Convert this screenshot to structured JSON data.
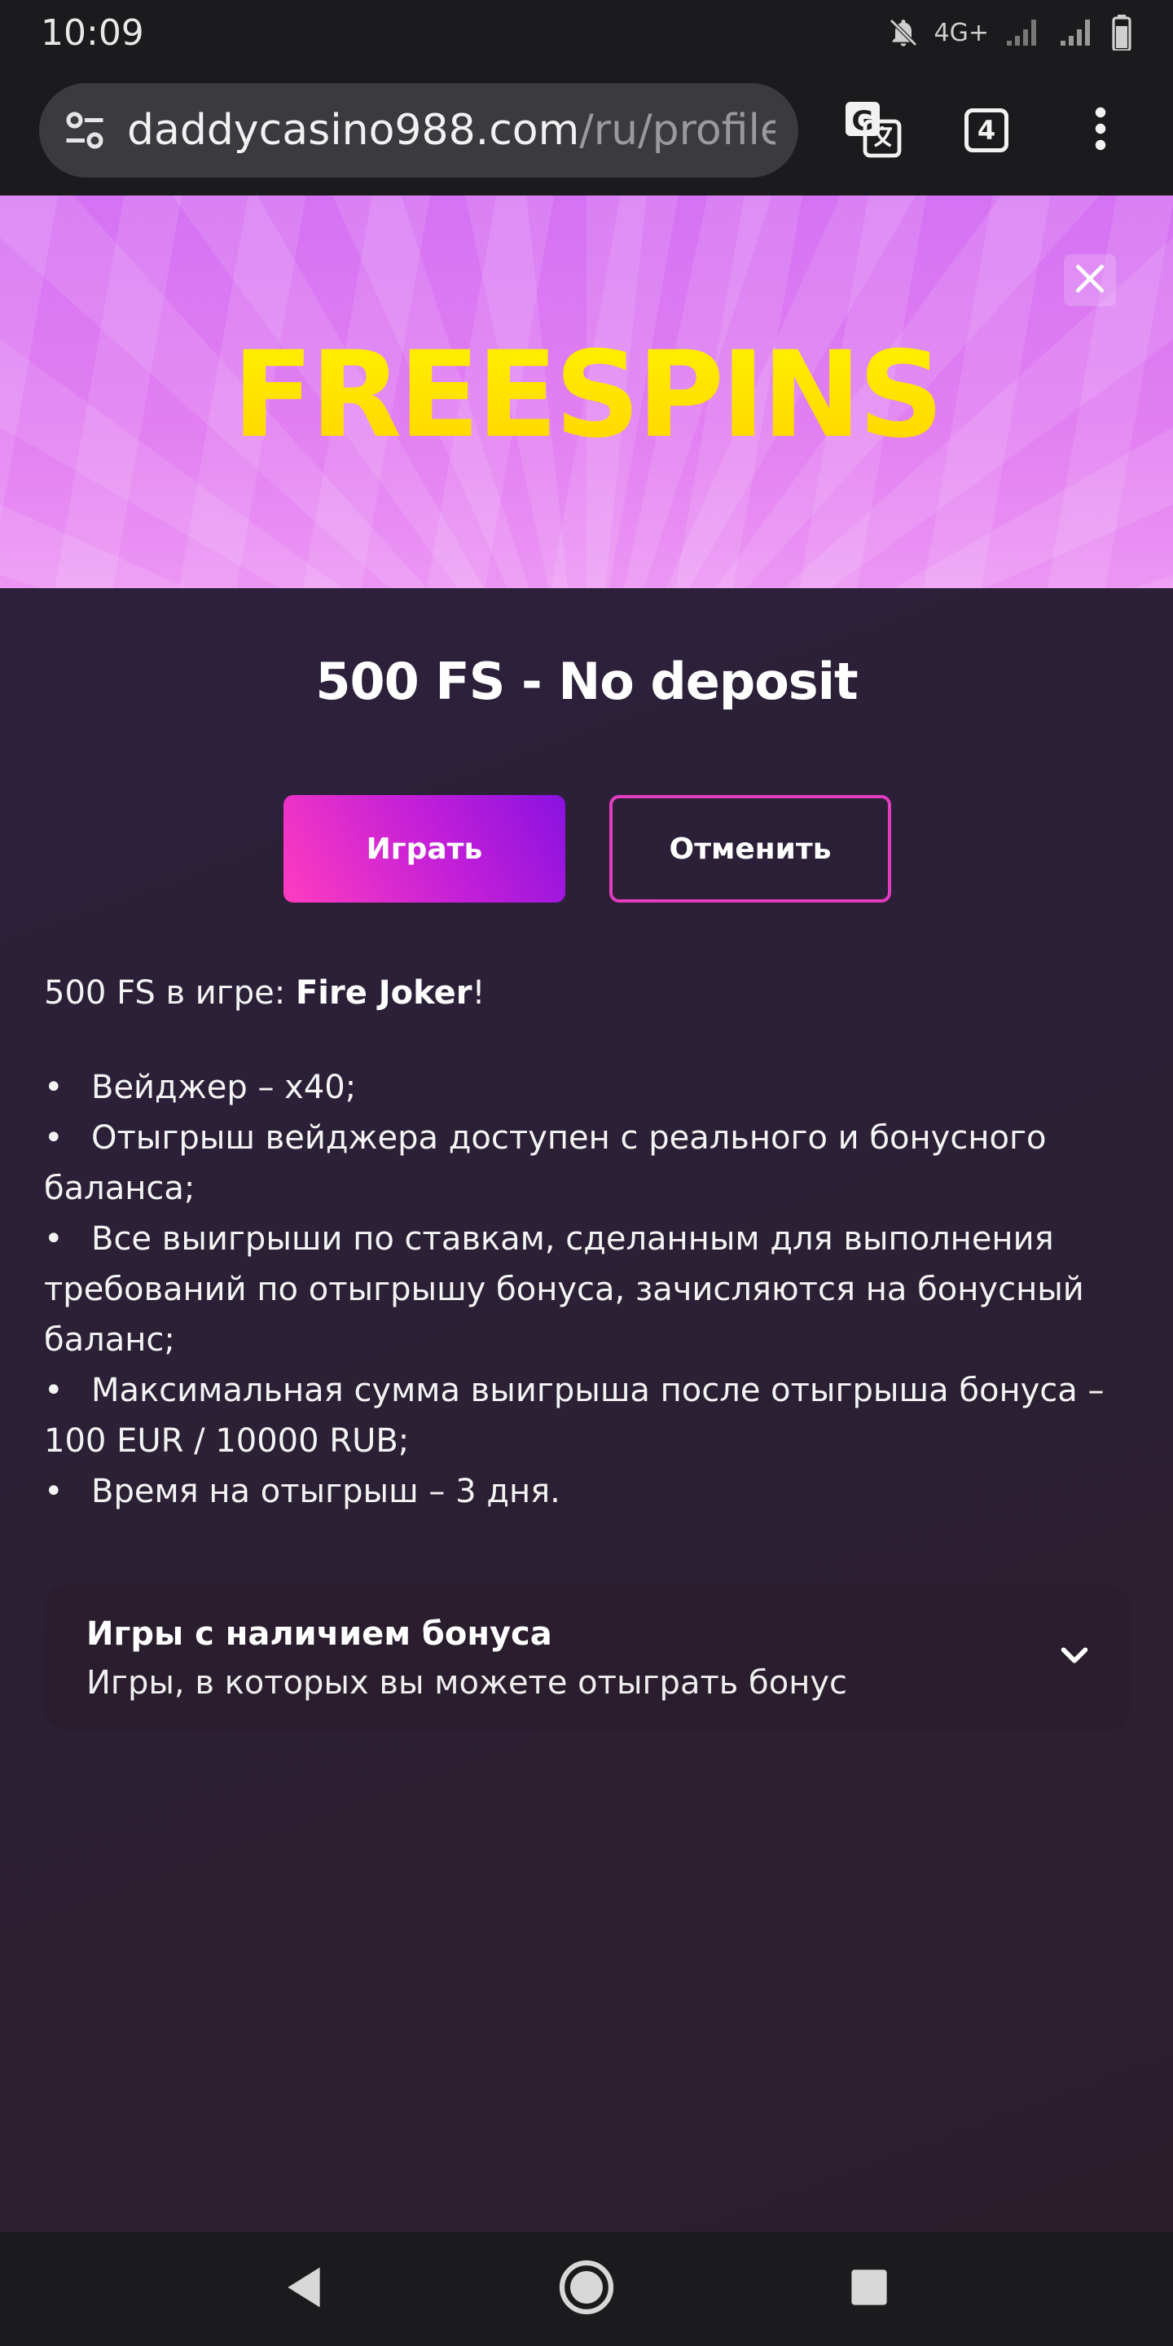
{
  "status_bar": {
    "time": "10:09",
    "network": "4G+",
    "icons": [
      "bell-off-icon",
      "signal-icon",
      "signal-icon",
      "battery-icon"
    ]
  },
  "browser": {
    "url_host": "daddycasino988.com",
    "url_path": "/ru/profile/lo",
    "tab_count": "4",
    "icons": [
      "site-settings-icon",
      "translate-icon",
      "tabs-icon",
      "more-vert-icon"
    ]
  },
  "banner": {
    "title": "FREESPINS",
    "close_icon": "close-icon"
  },
  "offer": {
    "title": "500 FS - No deposit",
    "play_label": "Играть",
    "cancel_label": "Отменить",
    "intro_prefix": "500 FS в игре: ",
    "intro_game": "Fire Joker",
    "intro_suffix": "!",
    "rules": [
      "Вейджер – x40;",
      "Отыгрыш вейджера доступен с реального и бонусного",
      "баланса;",
      "Все выигрыши по ставкам, сделанным для выполнения",
      "требований по отыгрышу бонуса, зачисляются на бонусный",
      "баланс;",
      "Максимальная сумма выигрыша после отыгрыша бонуса –",
      "100 EUR / 10000 RUB;",
      "Время на отыгрыш – 3 дня."
    ]
  },
  "games_accordion": {
    "title": "Игры с наличием бонуса",
    "subtitle": "Игры, в которых вы можете отыграть бонус",
    "chevron_icon": "chevron-down-icon"
  },
  "nav_bar": {
    "icons": [
      "back-icon",
      "home-icon",
      "recents-icon"
    ]
  },
  "colors": {
    "accent_pink": "#e23cc0",
    "accent_purple": "#8a12e0",
    "banner_yellow": "#ffe000",
    "banner_pink": "#e27ff2"
  }
}
